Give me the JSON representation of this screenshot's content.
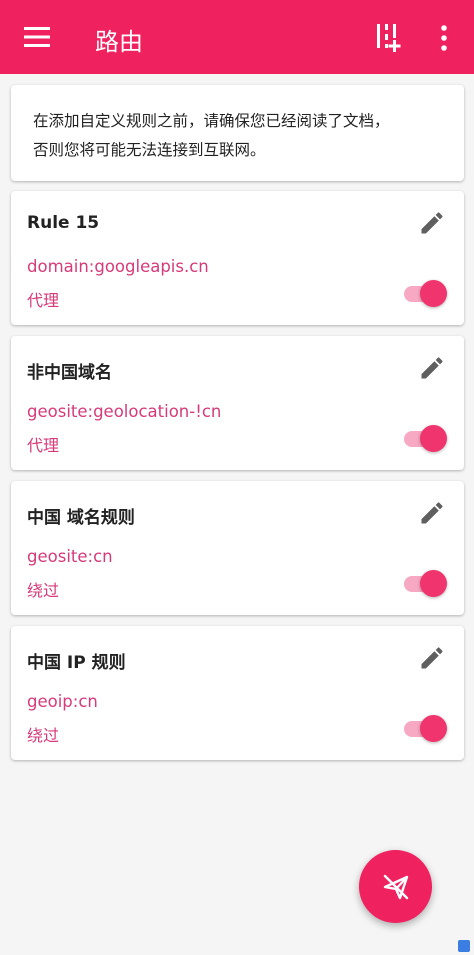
{
  "appbar": {
    "title": "路由",
    "menu_icon": "menu-icon",
    "add_icon": "add-rule-icon",
    "more_icon": "more-vert-icon",
    "color": "#f0215f"
  },
  "notice": {
    "line1": "在添加自定义规则之前，请确保您已经阅读了文档，",
    "line2": "否则您将可能无法连接到互联网。"
  },
  "rules": [
    {
      "name": "Rule 15",
      "domain": "domain:googleapis.cn",
      "action": "代理",
      "enabled": true
    },
    {
      "name": "非中国域名",
      "domain": "geosite:geolocation-!cn",
      "action": "代理",
      "enabled": true
    },
    {
      "name": "中国 域名规则",
      "domain": "geosite:cn",
      "action": "绕过",
      "enabled": true
    },
    {
      "name": "中国 IP 规则",
      "domain": "geoip:cn",
      "action": "绕过",
      "enabled": true
    }
  ],
  "fab": {
    "icon": "connect-plane-icon"
  },
  "accent_color": "#d63a7a"
}
